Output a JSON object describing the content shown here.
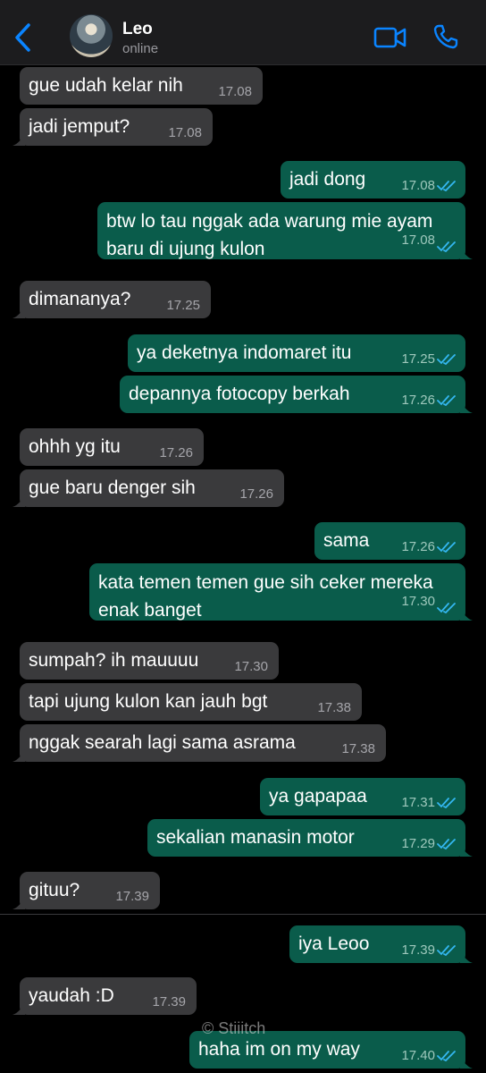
{
  "header": {
    "contact_name": "Leo",
    "status": "online",
    "icons": [
      "back-chevron-icon",
      "video-call-icon",
      "voice-call-icon"
    ],
    "accent_color": "#0a84ff"
  },
  "messages": [
    {
      "dir": "in",
      "text": "gue udah kelar nih",
      "time": "17.08"
    },
    {
      "dir": "in",
      "text": "jadi jemput?",
      "time": "17.08"
    },
    {
      "dir": "out",
      "text": "jadi dong",
      "time": "17.08",
      "read": true
    },
    {
      "dir": "out",
      "text_line1": "btw lo tau nggak ada warung mie ayam",
      "text_line2": "baru di ujung kulon",
      "time": "17.08",
      "read": true
    },
    {
      "dir": "in",
      "text": "dimananya?",
      "time": "17.25"
    },
    {
      "dir": "out",
      "text": "ya deketnya indomaret itu",
      "time": "17.25",
      "read": true
    },
    {
      "dir": "out",
      "text": "depannya fotocopy berkah",
      "time": "17.26",
      "read": true
    },
    {
      "dir": "in",
      "text": "ohhh yg itu",
      "time": "17.26"
    },
    {
      "dir": "in",
      "text": "gue baru denger sih",
      "time": "17.26"
    },
    {
      "dir": "out",
      "text": "sama",
      "time": "17.26",
      "read": true
    },
    {
      "dir": "out",
      "text_line1": "kata temen temen gue sih ceker mereka",
      "text_line2": "enak banget",
      "time": "17.30",
      "read": true
    },
    {
      "dir": "in",
      "text": "sumpah? ih mauuuu",
      "time": "17.30"
    },
    {
      "dir": "in",
      "text": "tapi ujung kulon kan jauh bgt",
      "time": "17.38"
    },
    {
      "dir": "in",
      "text": "nggak searah lagi sama asrama",
      "time": "17.38"
    },
    {
      "dir": "out",
      "text": "ya gapapaa",
      "time": "17.31",
      "read": true
    },
    {
      "dir": "out",
      "text": "sekalian manasin motor",
      "time": "17.29",
      "read": true
    },
    {
      "dir": "in",
      "text": "gituu?",
      "time": "17.39"
    },
    {
      "dir": "out",
      "text": "iya Leoo",
      "time": "17.39",
      "read": true
    },
    {
      "dir": "in",
      "text": "yaudah :D",
      "time": "17.39"
    },
    {
      "dir": "out",
      "text": "haha im on my way",
      "time": "17.40",
      "read": true
    }
  ],
  "colors": {
    "incoming_bubble": "#3a3a3c",
    "outgoing_bubble": "#0a5c4b",
    "read_ticks": "#34b7f1",
    "background": "#000000"
  },
  "watermark": "© Stiiitch"
}
